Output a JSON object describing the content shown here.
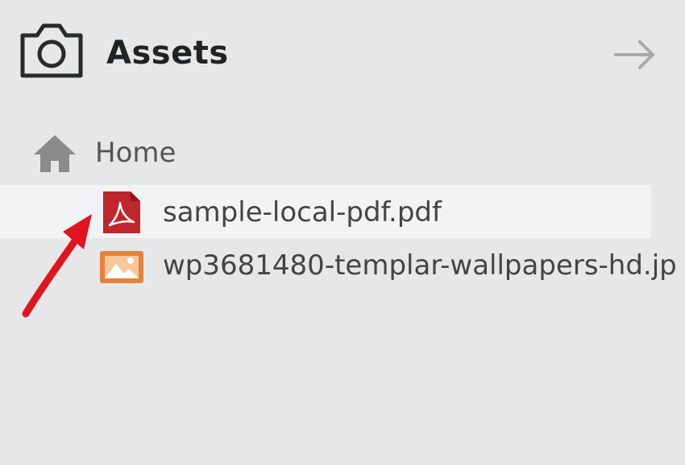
{
  "panel": {
    "title": "Assets",
    "header_icon": "camera-icon",
    "collapse_icon": "arrow-right-icon"
  },
  "tree": {
    "root": {
      "label": "Home",
      "icon": "home-icon"
    },
    "files": [
      {
        "name": "sample-local-pdf.pdf",
        "icon": "pdf-file-icon",
        "selected": true,
        "icon_color": "#c0262d"
      },
      {
        "name": "wp3681480-templar-wallpapers-hd.jp",
        "icon": "image-file-icon",
        "selected": false,
        "icon_color": "#e8823a"
      }
    ]
  },
  "annotation": {
    "icon": "red-arrow-annotation",
    "color": "#e0151f"
  }
}
